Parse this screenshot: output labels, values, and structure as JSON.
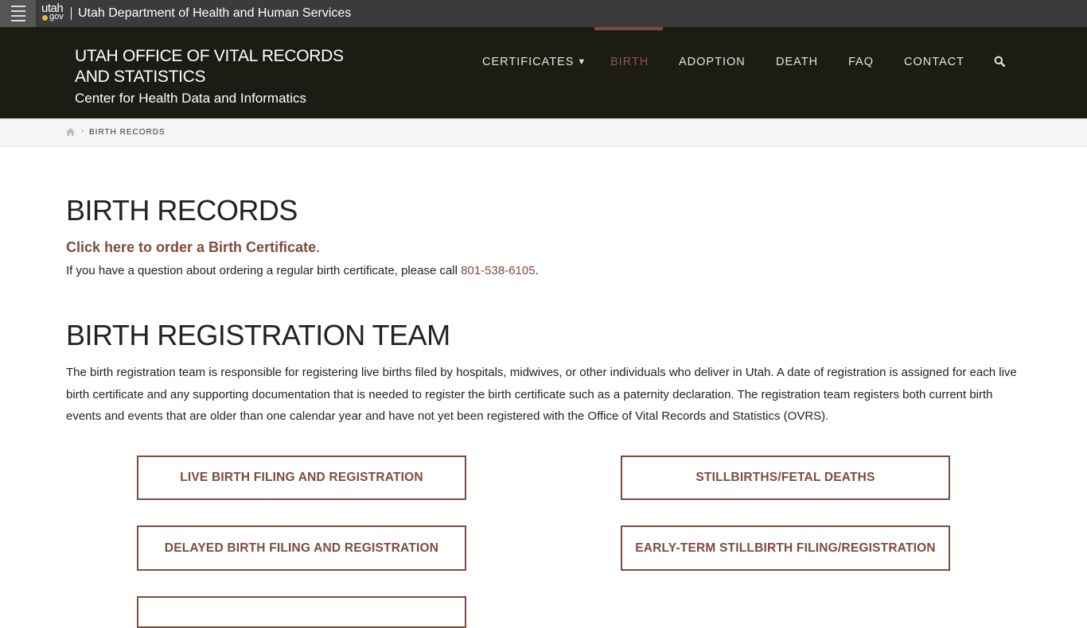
{
  "topbar": {
    "logo_top": "utah",
    "logo_bottom": "gov",
    "agency": "Utah Department of Health and Human Services"
  },
  "header": {
    "title": "UTAH OFFICE OF VITAL RECORDS AND STATISTICS",
    "subtitle": "Center for Health Data and Informatics"
  },
  "nav": {
    "items": [
      {
        "label": "CERTIFICATES",
        "active": false
      },
      {
        "label": "BIRTH",
        "active": true
      },
      {
        "label": "ADOPTION",
        "active": false
      },
      {
        "label": "DEATH",
        "active": false
      },
      {
        "label": "FAQ",
        "active": false
      },
      {
        "label": "CONTACT",
        "active": false
      }
    ]
  },
  "breadcrumb": {
    "current": "BIRTH RECORDS"
  },
  "main": {
    "title": "BIRTH RECORDS",
    "order_link": "Click here to order a Birth Certificate",
    "order_suffix": ".",
    "question_text": "If you have a question about ordering a regular birth certificate, please call ",
    "phone": "801-538-6105",
    "question_suffix": ".",
    "section_title": "BIRTH REGISTRATION TEAM",
    "paragraph": "The birth registration team is responsible for registering live births filed by hospitals, midwives, or other individuals who deliver in Utah. A date of registration is assigned for each live birth certificate and any supporting documentation that is needed to register the birth certificate such as a paternity declaration. The registration team registers both current birth events and events that are older than one calendar year and have not yet been registered with the Office of Vital Records and Statistics (OVRS).",
    "buttons": [
      "LIVE BIRTH FILING AND REGISTRATION",
      "STILLBIRTHS/FETAL DEATHS",
      "DELAYED BIRTH FILING AND REGISTRATION",
      "EARLY-TERM STILLBIRTH FILING/REGISTRATION",
      ""
    ]
  },
  "colors": {
    "accent": "#7e4b3e",
    "header_bg": "#1c1b14",
    "topbar_bg": "#3b3b3b"
  }
}
